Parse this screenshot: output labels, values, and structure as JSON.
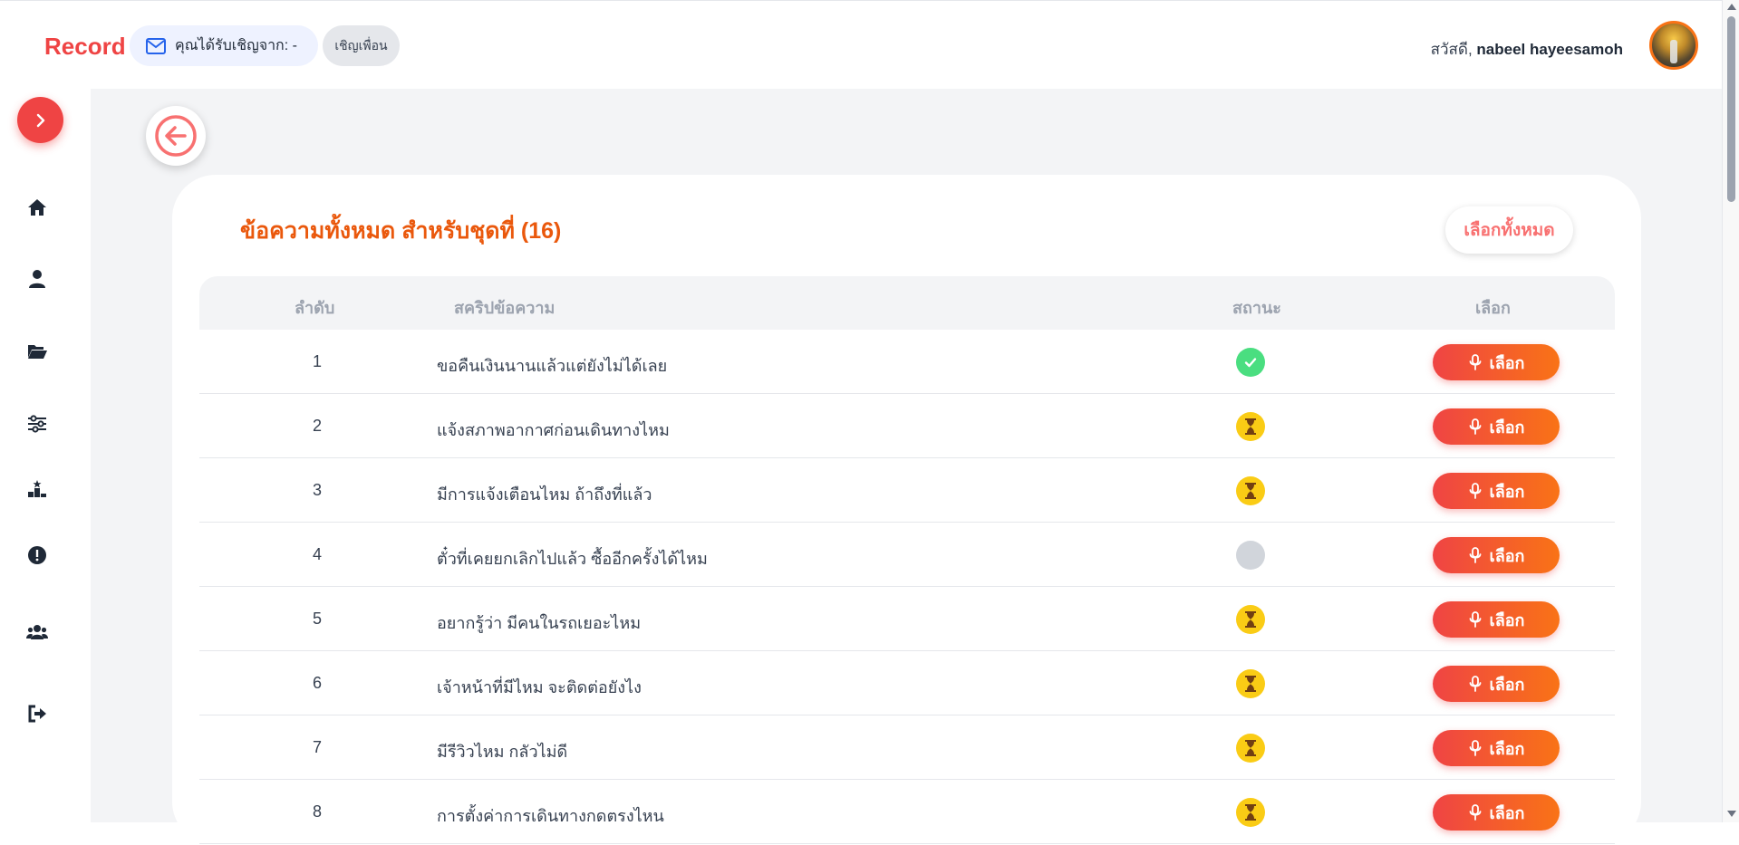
{
  "header": {
    "brand": "Record",
    "invite_text": "คุณได้รับเชิญจาก: -",
    "invite_friend_label": "เชิญเพื่อน",
    "greeting_prefix": "สวัสดี,",
    "user_name": "nabeel hayeesamoh"
  },
  "sidebar": {
    "items": [
      {
        "icon": "home-icon"
      },
      {
        "icon": "user-icon"
      },
      {
        "icon": "folder-open-icon"
      },
      {
        "icon": "sliders-icon"
      },
      {
        "icon": "leaderboard-icon"
      },
      {
        "icon": "alert-icon"
      },
      {
        "icon": "users-icon"
      },
      {
        "icon": "logout-icon"
      }
    ]
  },
  "card": {
    "title": "ข้อความทั้งหมด สำหรับชุดที่ (16)",
    "select_all_label": "เลือกทั้งหมด",
    "columns": [
      "ลำดับ",
      "สคริปข้อความ",
      "สถานะ",
      "เลือก"
    ],
    "rows": [
      {
        "num": "1",
        "script": "ขอคืนเงินนานแล้วแต่ยังไม่ได้เลย",
        "status": "done",
        "action": "เลือก"
      },
      {
        "num": "2",
        "script": "แจ้งสภาพอากาศก่อนเดินทางไหม",
        "status": "pending",
        "action": "เลือก"
      },
      {
        "num": "3",
        "script": "มีการแจ้งเตือนไหม ถ้าถึงที่แล้ว",
        "status": "pending",
        "action": "เลือก"
      },
      {
        "num": "4",
        "script": "ตั๋วที่เคยยกเลิกไปแล้ว ซื้ออีกครั้งได้ไหม",
        "status": "none",
        "action": "เลือก"
      },
      {
        "num": "5",
        "script": "อยากรู้ว่า มีคนในรถเยอะไหม",
        "status": "pending",
        "action": "เลือก"
      },
      {
        "num": "6",
        "script": "เจ้าหน้าที่มีไหม จะติดต่อยังไง",
        "status": "pending",
        "action": "เลือก"
      },
      {
        "num": "7",
        "script": "มีรีวิวไหม กลัวไม่ดี",
        "status": "pending",
        "action": "เลือก"
      },
      {
        "num": "8",
        "script": "การตั้งค่าการเดินทางกดตรงไหน",
        "status": "pending",
        "action": "เลือก"
      }
    ]
  },
  "colors": {
    "brand": "#ef4444",
    "title": "#ea580c",
    "done": "#4ade80",
    "pending": "#facc15",
    "none": "#d1d5db"
  }
}
